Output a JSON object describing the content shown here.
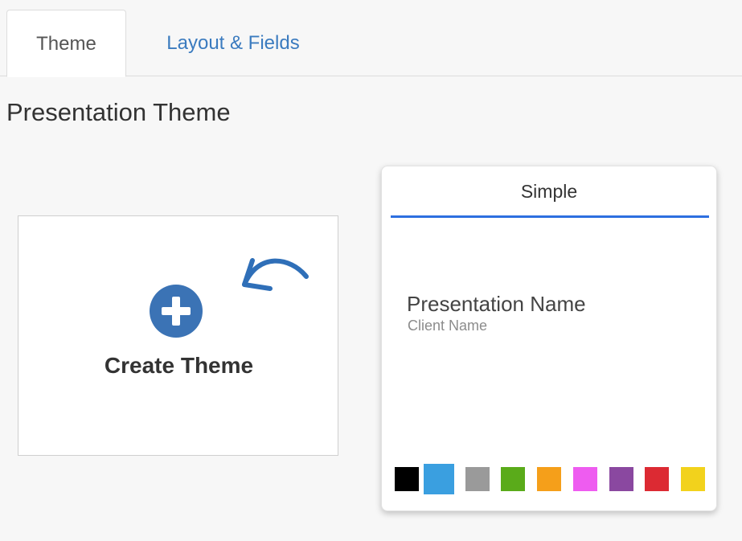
{
  "tabs": [
    {
      "label": "Theme",
      "active": true
    },
    {
      "label": "Layout & Fields",
      "active": false
    }
  ],
  "section_title": "Presentation Theme",
  "create_card": {
    "label": "Create Theme",
    "icon": "plus-circle-icon",
    "annotation_icon": "curved-arrow-icon",
    "icon_color": "#3b73b5"
  },
  "theme_card": {
    "name": "Simple",
    "accent_color": "#2d6fe0",
    "preview": {
      "title": "Presentation Name",
      "subtitle": "Client Name"
    },
    "swatches": [
      {
        "color": "#000000",
        "selected": false
      },
      {
        "color": "#3a9fe0",
        "selected": true
      },
      {
        "color": "#9a9a9a",
        "selected": false
      },
      {
        "color": "#5aab1a",
        "selected": false
      },
      {
        "color": "#f59f1a",
        "selected": false
      },
      {
        "color": "#ee5cf0",
        "selected": false
      },
      {
        "color": "#8a48a0",
        "selected": false
      },
      {
        "color": "#dc2a33",
        "selected": false
      },
      {
        "color": "#f2d21c",
        "selected": false
      }
    ]
  }
}
